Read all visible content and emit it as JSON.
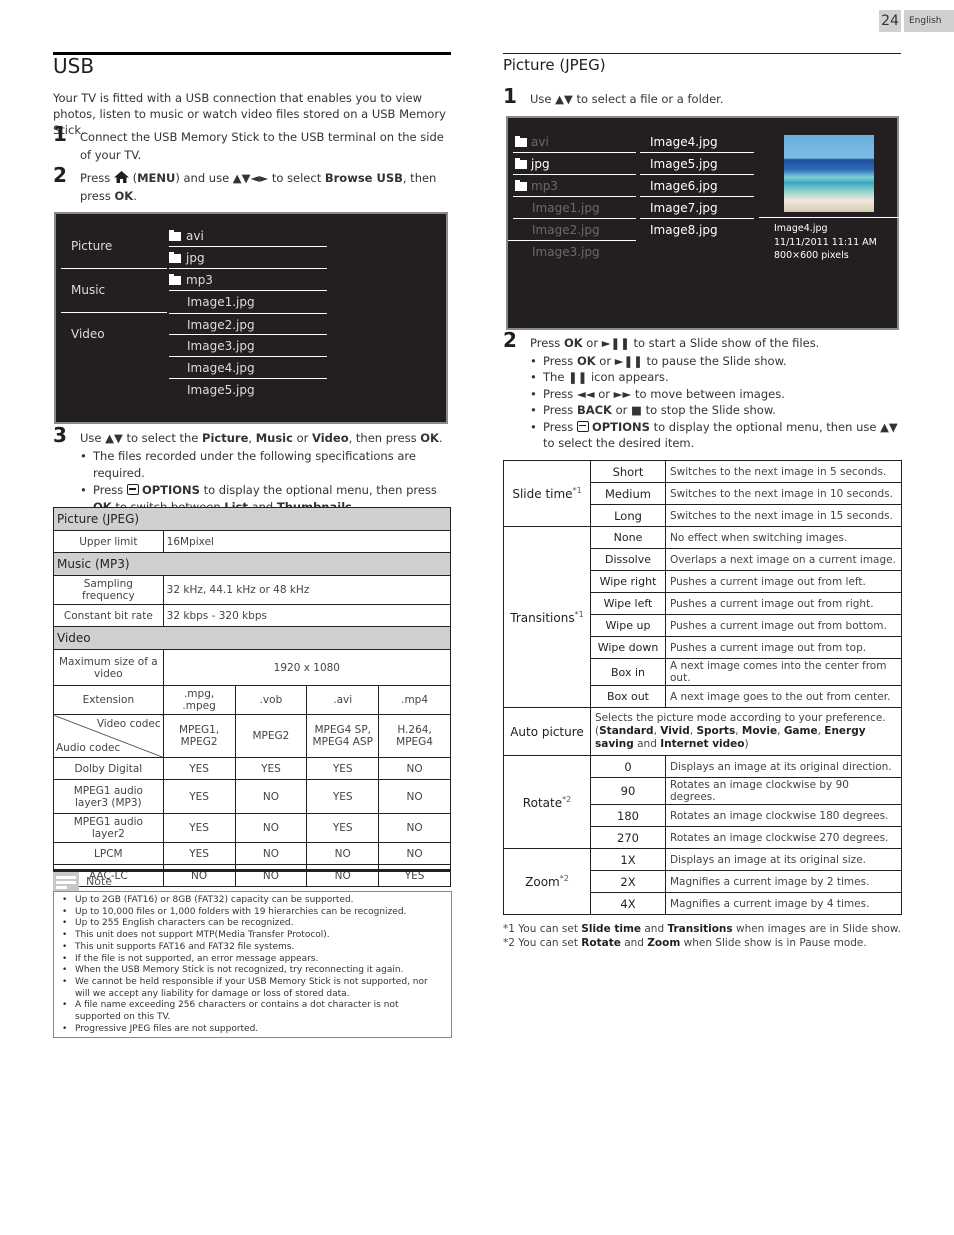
{
  "header": {
    "page_number": "24",
    "language": "English"
  },
  "left": {
    "title": "USB",
    "intro": "Your TV is fitted with a USB connection that enables you to view photos, listen to music or watch video files stored on a USB Memory Stick.",
    "step1": {
      "num": "1",
      "text": "Connect the USB Memory Stick to the USB terminal on the side of your TV."
    },
    "step2": {
      "num": "2",
      "t1": "Press",
      "t2": "(",
      "menu": "MENU",
      "t3": ")  and use ▲▼◄► to select",
      "browse": "Browse USB",
      "t4": ", then press",
      "ok": "OK",
      "t5": "."
    },
    "screen": {
      "categories": [
        "Picture",
        "Music",
        "Video"
      ],
      "items": [
        {
          "label": "avi",
          "folder": true
        },
        {
          "label": "jpg",
          "folder": true
        },
        {
          "label": "mp3",
          "folder": true
        },
        {
          "label": "Image1.jpg",
          "folder": false
        },
        {
          "label": "Image2.jpg",
          "folder": false
        },
        {
          "label": "Image3.jpg",
          "folder": false
        },
        {
          "label": "Image4.jpg",
          "folder": false
        },
        {
          "label": "Image5.jpg",
          "folder": false
        }
      ]
    },
    "step3": {
      "num": "3",
      "t1": "Use ▲▼ to select the",
      "picture": "Picture",
      "c1": ",",
      "music": "Music",
      "or": "or",
      "video": "Video",
      "t2": ", then press",
      "ok": "OK",
      "t3": ".",
      "bullet1": "The files recorded under the following specifications are required.",
      "b2_press": "Press",
      "b2_options": "OPTIONS",
      "b2_t1": "to display the optional menu, then press",
      "b2_ok": "OK",
      "b2_t2": "to switch between",
      "b2_list": "List",
      "b2_and": "and",
      "b2_thumb": "Thumbnails",
      "b2_end": "."
    },
    "spec_table": {
      "picture_header": "Picture (JPEG)",
      "upper_limit_label": "Upper limit",
      "upper_limit_value": "16Mpixel",
      "music_header": "Music (MP3)",
      "sampling_label": "Sampling frequency",
      "sampling_value": "32 kHz, 44.1 kHz or 48 kHz",
      "bitrate_label": "Constant bit rate",
      "bitrate_value": "32 kbps - 320 kbps",
      "video_header": "Video",
      "maxsize_label": "Maximum size of a video",
      "maxsize_value": "1920 x 1080",
      "extension_label": "Extension",
      "extensions": [
        ".mpg, .mpeg",
        ".vob",
        ".avi",
        ".mp4"
      ],
      "video_codec_label": "Video codec",
      "audio_codec_label": "Audio codec",
      "video_codecs": [
        "MPEG1, MPEG2",
        "MPEG2",
        "MPEG4 SP, MPEG4 ASP",
        "H.264, MPEG4"
      ],
      "rows": [
        {
          "codec": "Dolby Digital",
          "values": [
            "YES",
            "YES",
            "YES",
            "NO"
          ]
        },
        {
          "codec": "MPEG1 audio layer3 (MP3)",
          "values": [
            "YES",
            "NO",
            "YES",
            "NO"
          ]
        },
        {
          "codec": "MPEG1 audio layer2",
          "values": [
            "YES",
            "NO",
            "YES",
            "NO"
          ]
        },
        {
          "codec": "LPCM",
          "values": [
            "YES",
            "NO",
            "NO",
            "NO"
          ]
        },
        {
          "codec": "AAC-LC",
          "values": [
            "NO",
            "NO",
            "NO",
            "YES"
          ]
        }
      ]
    },
    "note": {
      "label": "Note",
      "items": [
        "Up to 2GB (FAT16) or 8GB (FAT32) capacity can be supported.",
        "Up to 10,000 files or 1,000 folders with 19 hierarchies can be recognized.",
        "Up to 255 English characters can be recognized.",
        "This unit does not support MTP(Media Transfer Protocol).",
        "This unit supports FAT16 and FAT32 file systems.",
        "If the file is not supported, an error message appears.",
        "When the USB Memory Stick is not recognized, try reconnecting it again.",
        "We cannot be held responsible if your USB Memory Stick is not supported, nor will we accept any liability for damage or loss of stored data.",
        "A file name exceeding 256 characters or contains a dot character is not supported on this TV.",
        "Progressive JPEG files are not supported."
      ]
    }
  },
  "right": {
    "title": "Picture (JPEG)",
    "step1": {
      "num": "1",
      "text": "Use ▲▼ to select a file or a folder."
    },
    "screen": {
      "col1": [
        {
          "label": "avi",
          "folder": true,
          "dim": true
        },
        {
          "label": "jpg",
          "folder": true,
          "dim": false
        },
        {
          "label": "mp3",
          "folder": true,
          "dim": true
        },
        {
          "label": "Image1.jpg",
          "folder": false,
          "dim": true
        },
        {
          "label": "Image2.jpg",
          "folder": false,
          "dim": true
        },
        {
          "label": "Image3.jpg",
          "folder": false,
          "dim": true
        }
      ],
      "col2": [
        "Image4.jpg",
        "Image5.jpg",
        "Image6.jpg",
        "Image7.jpg",
        "Image8.jpg"
      ],
      "preview": {
        "filename": "Image4.jpg",
        "datetime": "11/11/2011 11:11 AM",
        "size": "800×600 pixels"
      }
    },
    "step2": {
      "num": "2",
      "t1": "Press",
      "ok": "OK",
      "t2": "or ►❚❚ to start a Slide show of the files.",
      "b1_t1": "Press",
      "b1_ok": "OK",
      "b1_t2": "or ►❚❚ to pause the Slide show.",
      "b2": "The ❚❚ icon appears.",
      "b3": "Press ◄◄ or ►► to move between images.",
      "b4_t1": "Press",
      "b4_back": "BACK",
      "b4_t2": "or ■ to stop the Slide show.",
      "b5_t1": "Press",
      "b5_options": "OPTIONS",
      "b5_t2": " to display the optional menu, then use ▲▼ to select the desired item."
    },
    "options_table": {
      "groups": [
        {
          "name": "Slide time",
          "sup": "*1",
          "rows": [
            {
              "key": "Short",
              "desc": "Switches to the next image in 5 seconds."
            },
            {
              "key": "Medium",
              "desc": "Switches to the next image in 10 seconds."
            },
            {
              "key": "Long",
              "desc": "Switches to the next image in 15 seconds."
            }
          ]
        },
        {
          "name": "Transitions",
          "sup": "*1",
          "rows": [
            {
              "key": "None",
              "desc": "No effect when switching images."
            },
            {
              "key": "Dissolve",
              "desc": "Overlaps a next image on a current image."
            },
            {
              "key": "Wipe right",
              "desc": "Pushes a current image out from left."
            },
            {
              "key": "Wipe left",
              "desc": "Pushes a current image out from right."
            },
            {
              "key": "Wipe up",
              "desc": "Pushes a current image out from bottom."
            },
            {
              "key": "Wipe down",
              "desc": "Pushes a current image out from top."
            },
            {
              "key": "Box in",
              "desc": "A next image comes into the center from out."
            },
            {
              "key": "Box out",
              "desc": "A next image goes to the out from center."
            }
          ]
        },
        {
          "name": "Auto picture",
          "sup": "",
          "text_pre": "Selects the picture mode according to your preference. (",
          "modes": [
            "Standard",
            "Vivid",
            "Sports",
            "Movie",
            "Game",
            "Energy saving",
            "Internet video"
          ],
          "and": "and",
          "text_post": ")"
        },
        {
          "name": "Rotate",
          "sup": "*2",
          "rows": [
            {
              "key": "0",
              "desc": "Displays an image at its original direction."
            },
            {
              "key": "90",
              "desc": "Rotates an image clockwise by 90 degrees."
            },
            {
              "key": "180",
              "desc": "Rotates an image clockwise 180 degrees."
            },
            {
              "key": "270",
              "desc": "Rotates an image clockwise 270 degrees."
            }
          ]
        },
        {
          "name": "Zoom",
          "sup": "*2",
          "rows": [
            {
              "key": "1X",
              "desc": "Displays an image at its original size."
            },
            {
              "key": "2X",
              "desc": "Magnifies a current image by 2 times."
            },
            {
              "key": "4X",
              "desc": "Magnifies a current image by 4 times."
            }
          ]
        }
      ]
    },
    "footnotes": {
      "f1_pre": "*1 You can set",
      "f1_a": "Slide time",
      "f1_and": "and",
      "f1_b": "Transitions",
      "f1_post": "when images are in Slide show.",
      "f2_pre": "*2 You can set",
      "f2_a": "Rotate",
      "f2_and": "and",
      "f2_b": "Zoom",
      "f2_post": "when Slide show is in Pause mode."
    }
  }
}
